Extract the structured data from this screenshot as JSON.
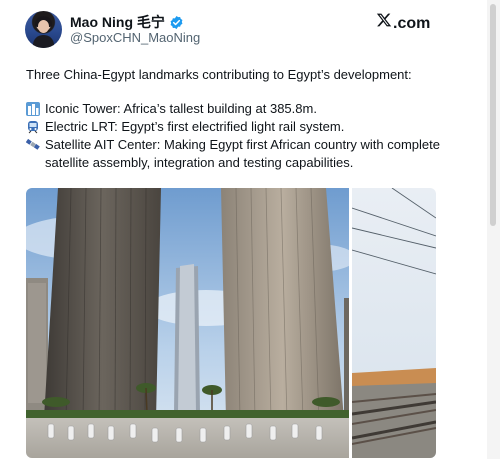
{
  "author": {
    "display_name": "Mao Ning 毛宁",
    "handle": "@SpoxCHN_MaoNing",
    "verified": true,
    "avatar_icon": "person-avatar"
  },
  "brand": {
    "text": ".com",
    "logo_icon": "x-logo-icon"
  },
  "tweet": {
    "intro": "Three China-Egypt landmarks contributing to Egypt’s development:",
    "items": [
      {
        "icon": "office-building-icon",
        "text": "Iconic Tower: Africa’s tallest building at 385.8m."
      },
      {
        "icon": "light-rail-icon",
        "text": "Electric LRT: Egypt’s first electrified light rail system."
      },
      {
        "icon": "satellite-icon",
        "text": "Satellite AIT Center: Making Egypt first African country with complete satellite assembly, integration and testing capabilities."
      }
    ]
  },
  "media": [
    {
      "name": "iconic-tower-photo"
    },
    {
      "name": "railway-photo"
    }
  ],
  "colors": {
    "verified_blue": "#1d9bf0",
    "handle_gray": "#536471",
    "text": "#0f1419"
  }
}
